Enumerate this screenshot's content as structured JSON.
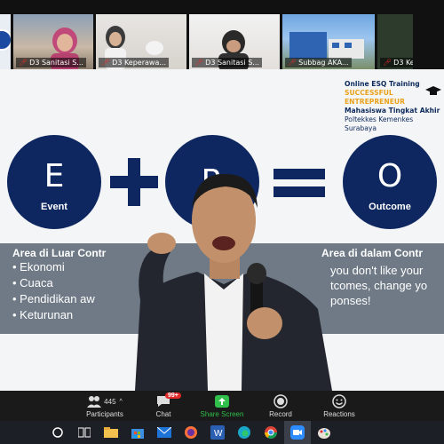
{
  "participants_strip": [
    {
      "name": ""
    },
    {
      "name": "D3 Sanitasi S..."
    },
    {
      "name": "D3 Keperawa..."
    },
    {
      "name": "D3 Sanitasi S..."
    },
    {
      "name": "Subbag AKA..."
    },
    {
      "name": "D3 Ke"
    }
  ],
  "slide": {
    "header": {
      "line1": "Online ESQ Training",
      "line2": "SUCCESSFUL ENTREPRENEUR",
      "line3": "Mahasiswa Tingkat Akhir",
      "line4": "Poltekkes Kemenkes Surabaya"
    },
    "circles": [
      {
        "letter": "E",
        "word": "Event"
      },
      {
        "letter": "R",
        "word": ""
      },
      {
        "letter": "O",
        "word": "Outcome"
      }
    ],
    "band": {
      "left_title": "Area di Luar Contr",
      "left_items": [
        "• Ekonomi",
        "• Cuaca",
        "• Pendidikan aw",
        "• Keturunan"
      ],
      "right_title": "Area di dalam Contr",
      "right_lines": [
        "you don't like your",
        "tcomes, change yo",
        "ponses!"
      ]
    }
  },
  "controls": {
    "participants": {
      "label": "Participants",
      "count": "445"
    },
    "chat": {
      "label": "Chat",
      "badge": "99+"
    },
    "share": {
      "label": "Share Screen"
    },
    "record": {
      "label": "Record"
    },
    "reactions": {
      "label": "Reactions"
    }
  },
  "colors": {
    "accent_navy": "#0f2760",
    "share_green": "#2fbf4a",
    "badge_red": "#e02a2a",
    "band_gray": "#6f7a86"
  }
}
